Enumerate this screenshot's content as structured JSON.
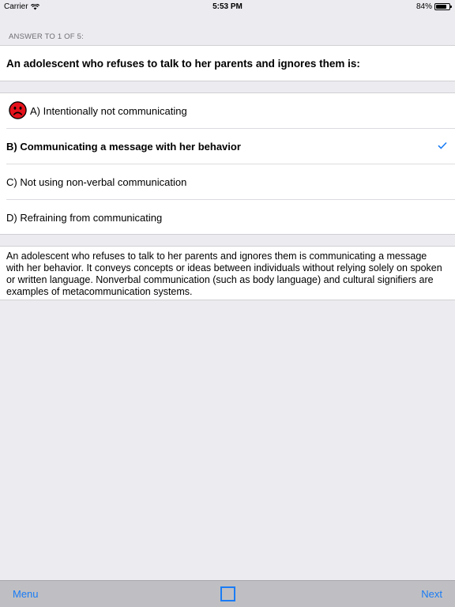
{
  "status_bar": {
    "carrier": "Carrier",
    "time": "5:53 PM",
    "battery": "84%",
    "battery_level": 0.84
  },
  "section_header": "ANSWER TO 1 OF 5:",
  "question": "An adolescent who refuses to talk to her parents and ignores them is:",
  "answers": [
    {
      "label": "A) Intentionally not communicating",
      "icon": "sad-face-icon"
    },
    {
      "label": "B) Communicating a message with her behavior",
      "icon": "checkmark-icon"
    },
    {
      "label": "C) Not using non-verbal communication"
    },
    {
      "label": "D) Refraining from communicating"
    }
  ],
  "explanation": "An adolescent who refuses to talk to her parents and ignores them is communicating a message with her behavior. It conveys concepts or ideas between individuals without relying solely on spoken or written language. Nonverbal communication (such as body language) and cultural signifiers are examples of metacommunication systems.",
  "toolbar": {
    "menu_label": "Menu",
    "next_label": "Next",
    "square_icon": "square-icon"
  },
  "colors": {
    "accent": "#1a7cf5",
    "wrong": "#e5121b",
    "background": "#ebebf0"
  }
}
